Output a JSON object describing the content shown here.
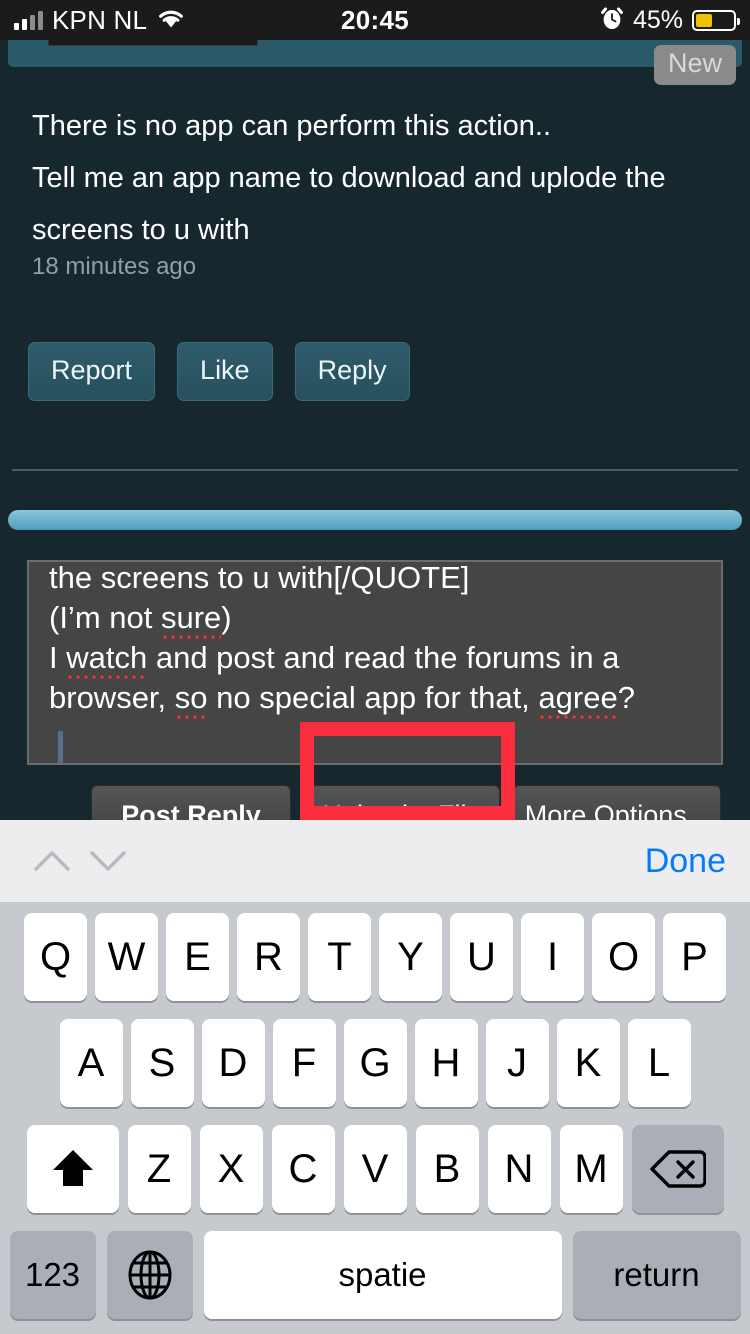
{
  "status_bar": {
    "carrier": "KPN NL",
    "time": "20:45",
    "battery_pct": "45%",
    "signal_icon": "signal-bars-icon",
    "wifi_icon": "wifi-icon",
    "alarm_icon": "alarm-clock-icon",
    "battery_icon": "battery-icon",
    "battery_color": "#f2c200"
  },
  "post": {
    "new_badge": "New",
    "lines": [
      "There is no app can perform this action..",
      "Tell me an app name to download and uplode the",
      "screens to u with"
    ],
    "timestamp": "18 minutes ago",
    "actions": [
      {
        "label": "Report"
      },
      {
        "label": "Like"
      },
      {
        "label": "Reply"
      }
    ]
  },
  "editor": {
    "lines": [
      {
        "segments": [
          {
            "text": "the screens to u with[/QUOTE]",
            "misspelled": false
          }
        ]
      },
      {
        "segments": [
          {
            "text": "(I’m not ",
            "misspelled": false
          },
          {
            "text": "sure",
            "misspelled": true
          },
          {
            "text": ")",
            "misspelled": false
          }
        ]
      },
      {
        "segments": [
          {
            "text": "I ",
            "misspelled": false
          },
          {
            "text": "watch",
            "misspelled": true
          },
          {
            "text": " and post and read the forums in a",
            "misspelled": false
          }
        ]
      },
      {
        "segments": [
          {
            "text": "browser, ",
            "misspelled": false
          },
          {
            "text": "so",
            "misspelled": true
          },
          {
            "text": " no special app for that, ",
            "misspelled": false
          },
          {
            "text": "agree",
            "misspelled": true
          },
          {
            "text": "?",
            "misspelled": false
          }
        ]
      }
    ],
    "misspell_color": "#ff2d2d",
    "caret_visible": true
  },
  "form_buttons": {
    "post_reply": "Post Reply",
    "upload_file": "Upload a File",
    "more_options": "More Options..."
  },
  "highlight": {
    "target": "Upload a File",
    "color": "#fb2e3f"
  },
  "keyboard_accessory": {
    "prev_icon": "chevron-up-icon",
    "next_icon": "chevron-down-icon",
    "done_label": "Done",
    "done_color": "#067aff"
  },
  "keyboard": {
    "language": "nl",
    "row1": [
      "Q",
      "W",
      "E",
      "R",
      "T",
      "Y",
      "U",
      "I",
      "O",
      "P"
    ],
    "row2": [
      "A",
      "S",
      "D",
      "F",
      "G",
      "H",
      "J",
      "K",
      "L"
    ],
    "row3": [
      "Z",
      "X",
      "C",
      "V",
      "B",
      "N",
      "M"
    ],
    "shift_icon": "shift-arrow-icon",
    "backspace_icon": "backspace-delete-icon",
    "numbers_label": "123",
    "globe_icon": "globe-language-icon",
    "space_label": "spatie",
    "return_label": "return"
  }
}
